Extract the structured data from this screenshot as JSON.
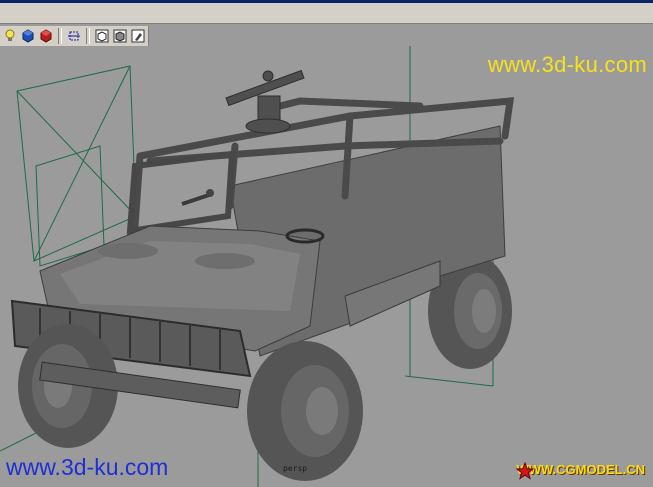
{
  "watermarks": {
    "top_right": "www.3d-ku.com",
    "bottom_left": "www.3d-ku.com",
    "bottom_right": "WWW.CGMODEL.CN"
  },
  "viewport": {
    "camera_label": "persp",
    "background_color": "#9b9b9b",
    "wire_color": "#1f6b47"
  },
  "toolbar": {
    "icons": [
      "lightbulb-icon",
      "blue-cube-icon",
      "red-cube-icon",
      "select-frame-icon",
      "wireframe-cube-icon",
      "shaded-cube-icon",
      "tool-icon"
    ]
  },
  "colors": {
    "top_watermark": "#f7e11a",
    "bottom_watermark": "#1e2fd6",
    "cg_watermark": "#ffd81a"
  }
}
